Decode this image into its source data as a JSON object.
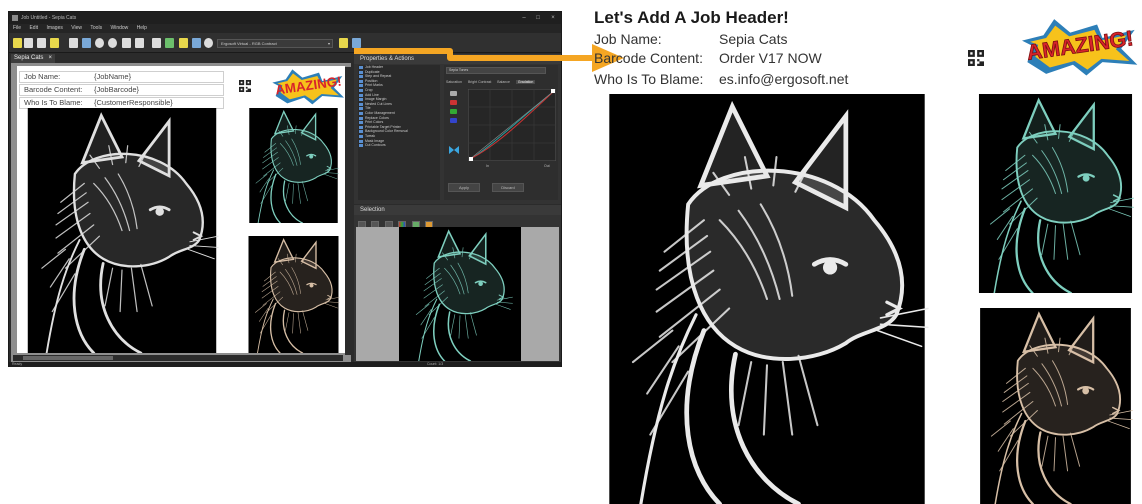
{
  "app": {
    "window_title": "Job Untitled - Sepia Cats",
    "window_controls": [
      "–",
      "□",
      "×"
    ],
    "menu": [
      "File",
      "Edit",
      "Images",
      "View",
      "Tools",
      "Window",
      "Help"
    ],
    "printer_select": "Ergosoft Virtual - RGB Contract",
    "doc_tab": "Sepia Cats",
    "header_rows": [
      {
        "key": "Job Name:",
        "value": "{JobName}"
      },
      {
        "key": "Barcode Content:",
        "value": "{JobBarcode}"
      },
      {
        "key": "Who Is To Blame:",
        "value": "{CustomerResponsible}"
      }
    ],
    "properties_title": "Properties & Actions",
    "properties_items": [
      "Job Header",
      "Duplicate",
      "Step and Repeat",
      "Position",
      "Print Marks",
      "Crop",
      "Add Line",
      "Image Margin",
      "Nested Cut Lines",
      "Tile",
      "Color Management",
      "Replace Colors",
      "Print Colors",
      "Printable Target Printer",
      "Background Color Removal",
      "Tweak",
      "Mask Image",
      "Cut Contours"
    ],
    "curve_select": "Sepia Tones",
    "curve_tabs": [
      "Saturation",
      "Bright Contrast",
      "Balance",
      "Gradation"
    ],
    "curve_active_tab": "Gradation",
    "curve_labels": {
      "in": "In",
      "out": "Out"
    },
    "buttons": {
      "apply": "Apply",
      "discard": "Discard"
    },
    "selection_title": "Selection",
    "status_left": "Ready",
    "status_center": "Count: 1/3"
  },
  "preview": {
    "title": "Let's Add A Job Header!",
    "rows": [
      {
        "key": "Job Name:",
        "value": "Sepia Cats"
      },
      {
        "key": "Barcode Content:",
        "value": "Order V17 NOW"
      },
      {
        "key": "Who Is To Blame:",
        "value": "es.info@ergosoft.net"
      }
    ],
    "logo_text": "AMAZING!"
  },
  "colors": {
    "arrow": "#f5a623",
    "teal_tone": "#7ecfbf",
    "sepia_tone": "#d7bfa6",
    "grey_tone": "#eaeaea",
    "logo_red": "#d8242a",
    "logo_yellow": "#f7c21b"
  }
}
